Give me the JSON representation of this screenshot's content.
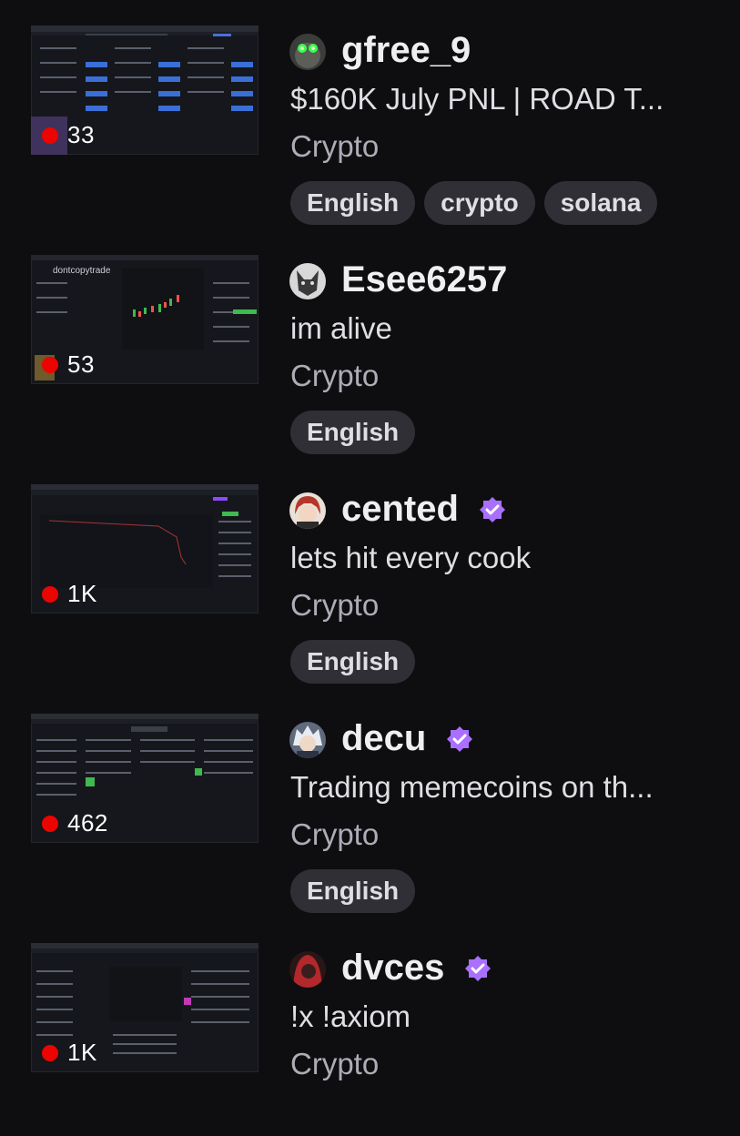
{
  "accent_color": "#9147ff",
  "live_color": "#eb0400",
  "streams": [
    {
      "viewers": "33",
      "channel": "gfree_9",
      "verified": false,
      "title": "$160K July PNL | ROAD T...",
      "category": "Crypto",
      "tags": [
        "English",
        "crypto",
        "solana"
      ],
      "avatar_icon": "goggles-avatar-icon",
      "thumb_overlay": ""
    },
    {
      "viewers": "53",
      "channel": "Esee6257",
      "verified": false,
      "title": "im alive",
      "category": "Crypto",
      "tags": [
        "English"
      ],
      "avatar_icon": "wolf-avatar-icon",
      "thumb_overlay": "dontcopytrade"
    },
    {
      "viewers": "1K",
      "channel": "cented",
      "verified": true,
      "title": "lets hit every cook",
      "category": "Crypto",
      "tags": [
        "English"
      ],
      "avatar_icon": "anime-redhair-avatar-icon",
      "thumb_overlay": ""
    },
    {
      "viewers": "462",
      "channel": "decu",
      "verified": true,
      "title": "Trading memecoins on th...",
      "category": "Crypto",
      "tags": [
        "English"
      ],
      "avatar_icon": "anime-whitehair-avatar-icon",
      "thumb_overlay": ""
    },
    {
      "viewers": "1K",
      "channel": "dvces",
      "verified": true,
      "title": "!x !axiom",
      "category": "Crypto",
      "tags": [],
      "avatar_icon": "red-hooded-avatar-icon",
      "thumb_overlay": ""
    }
  ]
}
